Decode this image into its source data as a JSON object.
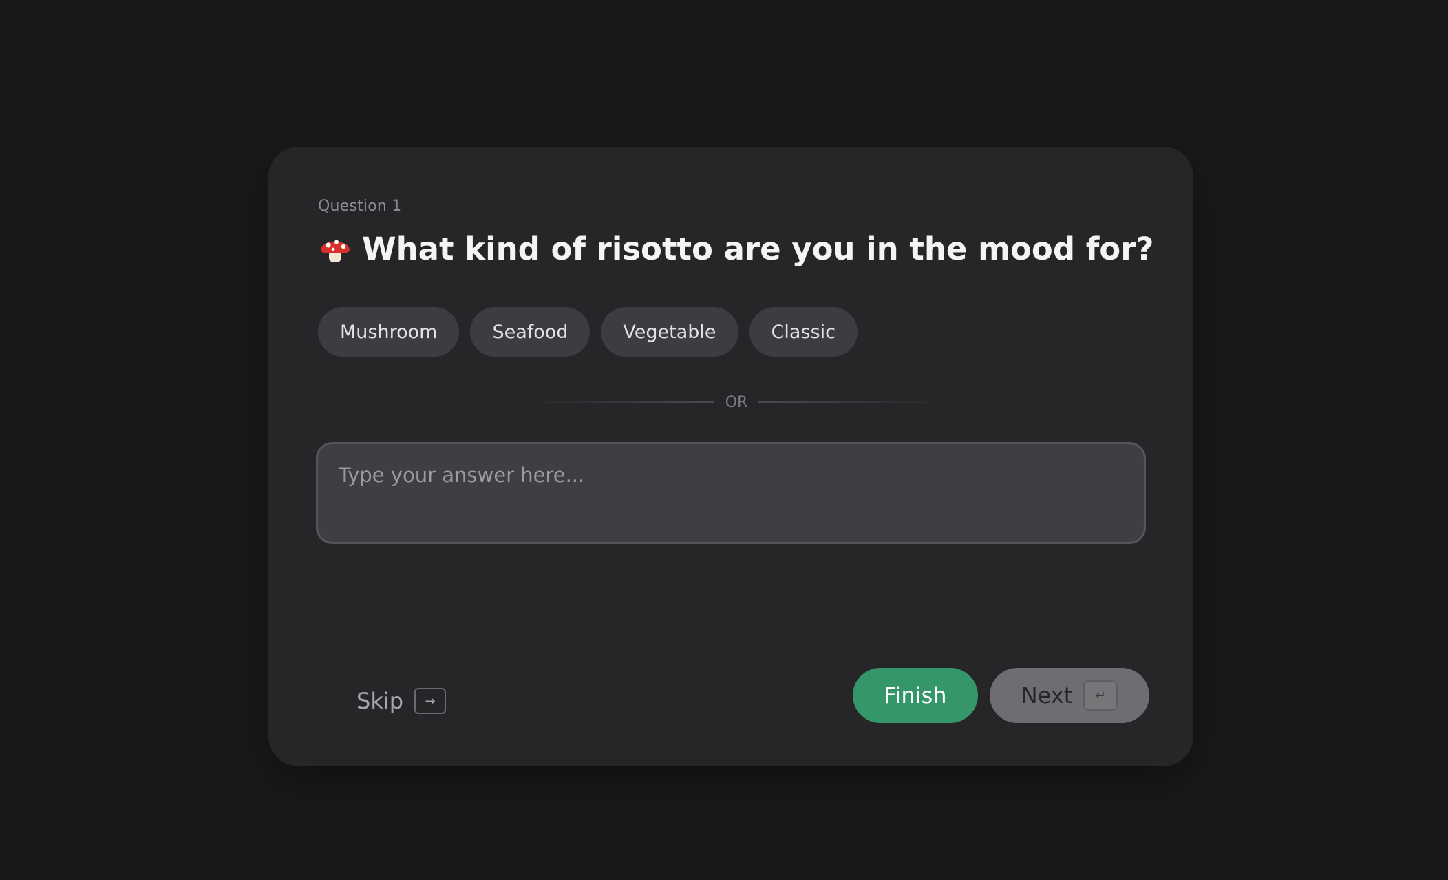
{
  "question": {
    "label": "Question 1",
    "icon": "mushroom-icon",
    "title": "What kind of risotto are you in the mood for?"
  },
  "options": [
    {
      "label": "Mushroom"
    },
    {
      "label": "Seafood"
    },
    {
      "label": "Vegetable"
    },
    {
      "label": "Classic"
    }
  ],
  "divider": {
    "label": "OR"
  },
  "answer": {
    "value": "",
    "placeholder": "Type your answer here..."
  },
  "footer": {
    "skip_label": "Skip",
    "skip_key": "→",
    "finish_label": "Finish",
    "next_label": "Next",
    "next_key": "↵"
  },
  "colors": {
    "background": "#19191b",
    "card": "#262628",
    "accent": "#35966a",
    "chip": "#3c3d42"
  }
}
